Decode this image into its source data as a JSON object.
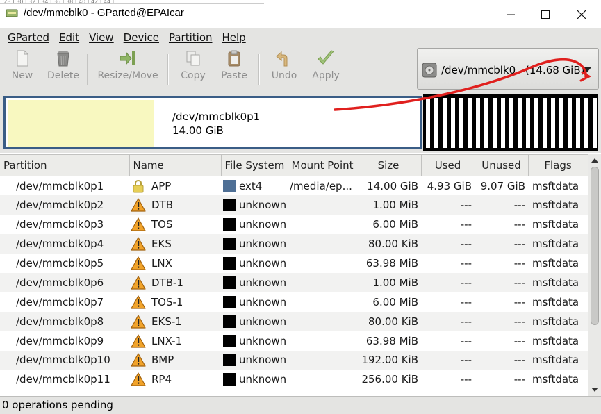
{
  "window": {
    "title": "/dev/mmcblk0 - GParted@EPAIcar",
    "ruler_text": "| 28 | 30 | 32 | 34 | 36 | 38 | 40 | 42 | 44 |"
  },
  "menubar": {
    "items": [
      "GParted",
      "Edit",
      "View",
      "Device",
      "Partition",
      "Help"
    ]
  },
  "toolbar": {
    "new": "New",
    "delete": "Delete",
    "resize_move": "Resize/Move",
    "copy": "Copy",
    "paste": "Paste",
    "undo": "Undo",
    "apply": "Apply"
  },
  "device": {
    "path": "/dev/mmcblk0",
    "size": "(14.68 GiB)"
  },
  "graph": {
    "partition_name": "/dev/mmcblk0p1",
    "partition_size": "14.00 GiB"
  },
  "table": {
    "headers": {
      "partition": "Partition",
      "name": "Name",
      "file_system": "File System",
      "mount_point": "Mount Point",
      "size": "Size",
      "used": "Used",
      "unused": "Unused",
      "flags": "Flags"
    },
    "rows": [
      {
        "partition": "/dev/mmcblk0p1",
        "status_icon": "lock-icon",
        "name": "APP",
        "fs": "ext4",
        "fs_color": "#4e6f95",
        "mount": "/media/ep...",
        "size": "14.00 GiB",
        "used": "4.93 GiB",
        "unused": "9.07 GiB",
        "flags": "msftdata"
      },
      {
        "partition": "/dev/mmcblk0p2",
        "status_icon": "warning-icon",
        "name": "DTB",
        "fs": "unknown",
        "fs_color": "#000000",
        "mount": "",
        "size": "1.00 MiB",
        "used": "---",
        "unused": "---",
        "flags": "msftdata"
      },
      {
        "partition": "/dev/mmcblk0p3",
        "status_icon": "warning-icon",
        "name": "TOS",
        "fs": "unknown",
        "fs_color": "#000000",
        "mount": "",
        "size": "6.00 MiB",
        "used": "---",
        "unused": "---",
        "flags": "msftdata"
      },
      {
        "partition": "/dev/mmcblk0p4",
        "status_icon": "warning-icon",
        "name": "EKS",
        "fs": "unknown",
        "fs_color": "#000000",
        "mount": "",
        "size": "80.00 KiB",
        "used": "---",
        "unused": "---",
        "flags": "msftdata"
      },
      {
        "partition": "/dev/mmcblk0p5",
        "status_icon": "warning-icon",
        "name": "LNX",
        "fs": "unknown",
        "fs_color": "#000000",
        "mount": "",
        "size": "63.98 MiB",
        "used": "---",
        "unused": "---",
        "flags": "msftdata"
      },
      {
        "partition": "/dev/mmcblk0p6",
        "status_icon": "warning-icon",
        "name": "DTB-1",
        "fs": "unknown",
        "fs_color": "#000000",
        "mount": "",
        "size": "1.00 MiB",
        "used": "---",
        "unused": "---",
        "flags": "msftdata"
      },
      {
        "partition": "/dev/mmcblk0p7",
        "status_icon": "warning-icon",
        "name": "TOS-1",
        "fs": "unknown",
        "fs_color": "#000000",
        "mount": "",
        "size": "6.00 MiB",
        "used": "---",
        "unused": "---",
        "flags": "msftdata"
      },
      {
        "partition": "/dev/mmcblk0p8",
        "status_icon": "warning-icon",
        "name": "EKS-1",
        "fs": "unknown",
        "fs_color": "#000000",
        "mount": "",
        "size": "80.00 KiB",
        "used": "---",
        "unused": "---",
        "flags": "msftdata"
      },
      {
        "partition": "/dev/mmcblk0p9",
        "status_icon": "warning-icon",
        "name": "LNX-1",
        "fs": "unknown",
        "fs_color": "#000000",
        "mount": "",
        "size": "63.98 MiB",
        "used": "---",
        "unused": "---",
        "flags": "msftdata"
      },
      {
        "partition": "/dev/mmcblk0p10",
        "status_icon": "warning-icon",
        "name": "BMP",
        "fs": "unknown",
        "fs_color": "#000000",
        "mount": "",
        "size": "192.00 KiB",
        "used": "---",
        "unused": "---",
        "flags": "msftdata"
      },
      {
        "partition": "/dev/mmcblk0p11",
        "status_icon": "warning-icon",
        "name": "RP4",
        "fs": "unknown",
        "fs_color": "#000000",
        "mount": "",
        "size": "256.00 KiB",
        "used": "---",
        "unused": "---",
        "flags": "msftdata"
      }
    ]
  },
  "status": {
    "text": "0 operations pending"
  },
  "colors": {
    "partition_border": "#3a5d86",
    "used_fill": "#f8f8c0",
    "annotation_red": "#e0201e"
  }
}
